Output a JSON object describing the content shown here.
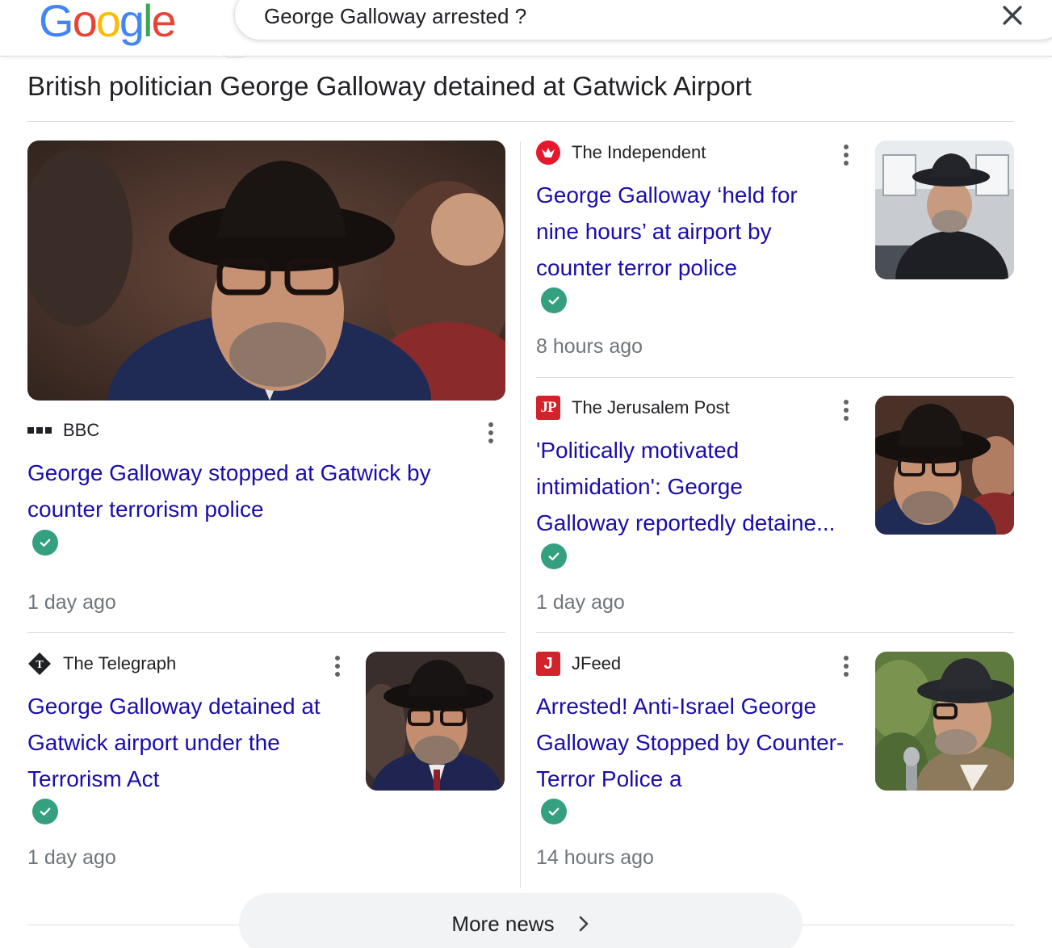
{
  "header": {
    "logo_letters": [
      "G",
      "o",
      "o",
      "g",
      "l",
      "e"
    ],
    "logo_colors": [
      "#4285F4",
      "#EA4335",
      "#FBBC05",
      "#4285F4",
      "#34A853",
      "#EA4335"
    ],
    "search_value": "George Galloway arrested ?"
  },
  "headline": "British politician George Galloway detained at Gatwick Airport",
  "cards": {
    "bbc": {
      "source": "BBC",
      "title_lines": [
        "George Galloway stopped at Gatwick by",
        "counter terrorism police"
      ],
      "time": "1 day ago"
    },
    "independent": {
      "source": "The Independent",
      "title_lines": [
        "George Galloway ‘held for",
        "nine hours’ at airport by",
        "counter terror police"
      ],
      "time": "8 hours ago"
    },
    "jpost": {
      "source": "The Jerusalem Post",
      "logo_text": "JP",
      "title_lines": [
        "'Politically motivated",
        "intimidation': George",
        "Galloway reportedly detaine..."
      ],
      "time": "1 day ago"
    },
    "telegraph": {
      "source": "The Telegraph",
      "title_lines": [
        "George Galloway detained at",
        "Gatwick airport under the",
        "Terrorism Act"
      ],
      "time": "1 day ago"
    },
    "jfeed": {
      "source": "JFeed",
      "logo_text": "J",
      "title_lines": [
        "Arrested! Anti-Israel George",
        "Galloway Stopped by Counter-",
        "Terror Police a"
      ],
      "time": "14 hours ago"
    }
  },
  "more_news_label": "More news",
  "colors": {
    "link": "#1a0dab",
    "verified": "#34a07f",
    "muted": "#70757a"
  }
}
